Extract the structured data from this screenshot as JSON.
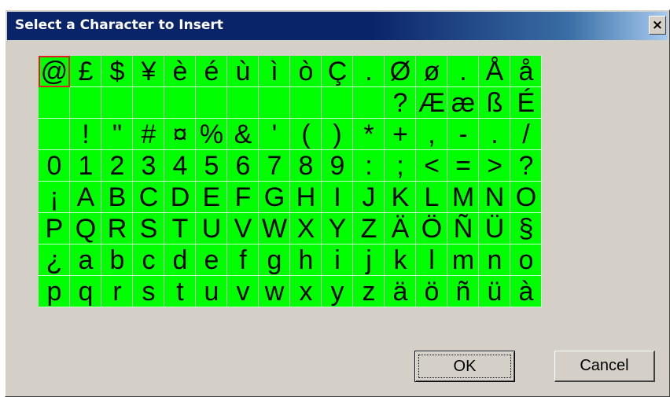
{
  "dialog": {
    "title": "Select a Character to Insert",
    "close_label": "×"
  },
  "characters": [
    "@",
    "£",
    "$",
    "¥",
    "è",
    "é",
    "ù",
    "ì",
    "ò",
    "Ç",
    ".",
    "Ø",
    "ø",
    ".",
    "Å",
    "å",
    "",
    "",
    "",
    "",
    "",
    "",
    "",
    "",
    "",
    "",
    "",
    "?",
    "Æ",
    "æ",
    "ß",
    "É",
    "",
    "!",
    "\"",
    "#",
    "¤",
    "%",
    "&",
    "'",
    "(",
    ")",
    "*",
    "+",
    ",",
    "-",
    ".",
    "/",
    "0",
    "1",
    "2",
    "3",
    "4",
    "5",
    "6",
    "7",
    "8",
    "9",
    ":",
    ";",
    "<",
    "=",
    ">",
    "?",
    "¡",
    "A",
    "B",
    "C",
    "D",
    "E",
    "F",
    "G",
    "H",
    "I",
    "J",
    "K",
    "L",
    "M",
    "N",
    "O",
    "P",
    "Q",
    "R",
    "S",
    "T",
    "U",
    "V",
    "W",
    "X",
    "Y",
    "Z",
    "Ä",
    "Ö",
    "Ñ",
    "Ü",
    "§",
    "¿",
    "a",
    "b",
    "c",
    "d",
    "e",
    "f",
    "g",
    "h",
    "i",
    "j",
    "k",
    "l",
    "m",
    "n",
    "o",
    "p",
    "q",
    "r",
    "s",
    "t",
    "u",
    "v",
    "w",
    "x",
    "y",
    "z",
    "ä",
    "ö",
    "ñ",
    "ü",
    "à"
  ],
  "selected_index": 0,
  "buttons": {
    "ok_label": "OK",
    "cancel_label": "Cancel"
  },
  "colors": {
    "grid_background": "#00ff00",
    "selection": "#e02020",
    "titlebar": "#0a246a"
  }
}
